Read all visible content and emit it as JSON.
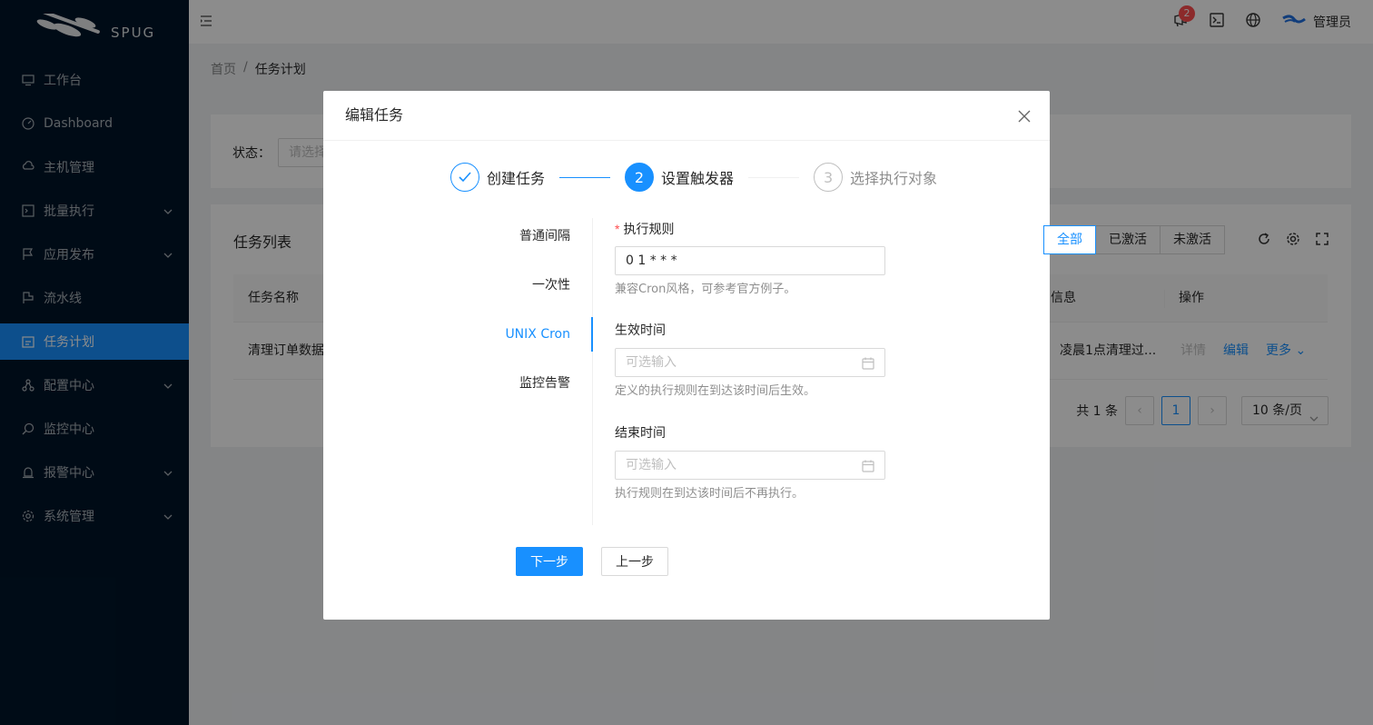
{
  "app": {
    "logo_text": "SPUG"
  },
  "sidebar": {
    "items": [
      {
        "label": "工作台",
        "icon": "desktop-icon",
        "has_arrow": false,
        "active": false
      },
      {
        "label": "Dashboard",
        "icon": "dashboard-icon",
        "has_arrow": false,
        "active": false
      },
      {
        "label": "主机管理",
        "icon": "cloud-server-icon",
        "has_arrow": false,
        "active": false
      },
      {
        "label": "批量执行",
        "icon": "code-icon",
        "has_arrow": true,
        "active": false
      },
      {
        "label": "应用发布",
        "icon": "flag-icon",
        "has_arrow": true,
        "active": false
      },
      {
        "label": "流水线",
        "icon": "pipeline-icon",
        "has_arrow": false,
        "active": false
      },
      {
        "label": "任务计划",
        "icon": "schedule-icon",
        "has_arrow": false,
        "active": true
      },
      {
        "label": "配置中心",
        "icon": "deployment-icon",
        "has_arrow": true,
        "active": false
      },
      {
        "label": "监控中心",
        "icon": "monitor-icon",
        "has_arrow": false,
        "active": false
      },
      {
        "label": "报警中心",
        "icon": "alert-icon",
        "has_arrow": true,
        "active": false
      },
      {
        "label": "系统管理",
        "icon": "setting-icon",
        "has_arrow": true,
        "active": false
      }
    ]
  },
  "header": {
    "notification_count": "2",
    "user_name": "管理员"
  },
  "breadcrumb": {
    "home": "首页",
    "separator": "/",
    "current": "任务计划"
  },
  "filter": {
    "status_label": "状态：",
    "status_placeholder": "请选择"
  },
  "table": {
    "title": "任务列表",
    "segments": [
      "全部",
      "已激活",
      "未激活"
    ],
    "columns": {
      "name": "任务名称",
      "info": "信息",
      "actions": "操作"
    },
    "row": {
      "name": "清理订单数据",
      "info": "凌晨1点清理过...",
      "detail": "详情",
      "edit": "编辑",
      "more": "更多"
    },
    "pagination": {
      "total": "共 1 条",
      "current": "1",
      "page_size": "10 条/页"
    }
  },
  "modal": {
    "title": "编辑任务",
    "steps": [
      {
        "number": "1",
        "title": "创建任务",
        "state": "done"
      },
      {
        "number": "2",
        "title": "设置触发器",
        "state": "active"
      },
      {
        "number": "3",
        "title": "选择执行对象",
        "state": "wait"
      }
    ],
    "tabs": [
      "普通间隔",
      "一次性",
      "UNIX Cron",
      "监控告警"
    ],
    "active_tab": "UNIX Cron",
    "form": {
      "rule_label": "执行规则",
      "rule_value": "0 1 * * *",
      "rule_help": "兼容Cron风格，可参考官方例子。",
      "start_label": "生效时间",
      "start_placeholder": "可选输入",
      "start_help": "定义的执行规则在到达该时间后生效。",
      "end_label": "结束时间",
      "end_placeholder": "可选输入",
      "end_help": "执行规则在到达该时间后不再执行。"
    },
    "buttons": {
      "next": "下一步",
      "prev": "上一步"
    }
  },
  "colors": {
    "primary": "#1890ff",
    "sidebar_bg": "#001529",
    "danger": "#ff4d4f"
  }
}
